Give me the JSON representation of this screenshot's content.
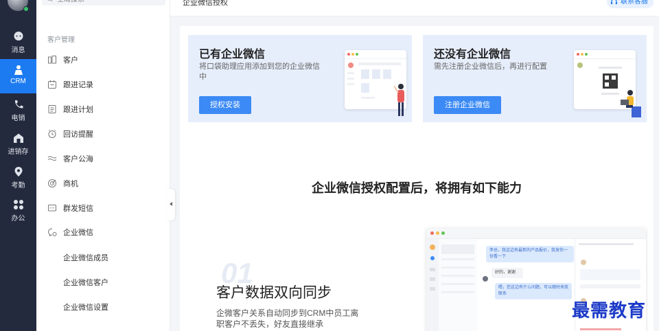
{
  "rail": {
    "items": [
      {
        "label": "消息",
        "icon": "chat-icon"
      },
      {
        "label": "CRM",
        "icon": "crm-icon"
      },
      {
        "label": "电销",
        "icon": "phone-icon"
      },
      {
        "label": "进销存",
        "icon": "warehouse-icon"
      },
      {
        "label": "考勤",
        "icon": "location-icon"
      },
      {
        "label": "办公",
        "icon": "apps-icon"
      }
    ],
    "active_color": "#1d7bf2"
  },
  "subnav": {
    "search_placeholder": "全局搜索",
    "group_title": "客户管理",
    "items": [
      {
        "label": "客户",
        "icon": "customer-icon"
      },
      {
        "label": "跟进记录",
        "icon": "record-icon"
      },
      {
        "label": "跟进计划",
        "icon": "plan-icon"
      },
      {
        "label": "回访提醒",
        "icon": "alarm-icon"
      },
      {
        "label": "客户公海",
        "icon": "waves-icon"
      },
      {
        "label": "商机",
        "icon": "opportunity-icon"
      },
      {
        "label": "群发短信",
        "icon": "sms-icon"
      },
      {
        "label": "企业微信",
        "icon": "wecom-icon"
      }
    ],
    "sub_items": [
      "企业微信成员",
      "企业微信客户",
      "企业微信设置"
    ]
  },
  "header": {
    "title": "企业微信授权",
    "contact_label": "联系客服"
  },
  "cards": [
    {
      "title": "已有企业微信",
      "desc": "将口袋助理应用添加到您的企业微信中",
      "button": "授权安装"
    },
    {
      "title": "还没有企业微信",
      "desc": "需先注册企业微信后，再进行配置",
      "button": "注册企业微信"
    }
  ],
  "headline": "企业微信授权配置后，将拥有如下能力",
  "feature": {
    "number": "01",
    "title": "客户数据双向同步",
    "desc": "企微客户关系自动同步到CRM中员工离职客户不丢失，好友直接继承"
  },
  "preview": {
    "msg1": "李总，我这边有最新的产品报价，我发你一份看一下",
    "msg2": "好的，谢谢",
    "msg3": "嗯，您这边有什么问题，可以随时来我联系"
  },
  "watermark": "最需教育",
  "colors": {
    "primary": "#1d7bf2",
    "button": "#3b8af5",
    "card_bg": "#e7eefb",
    "rail_bg": "#242a3e"
  }
}
